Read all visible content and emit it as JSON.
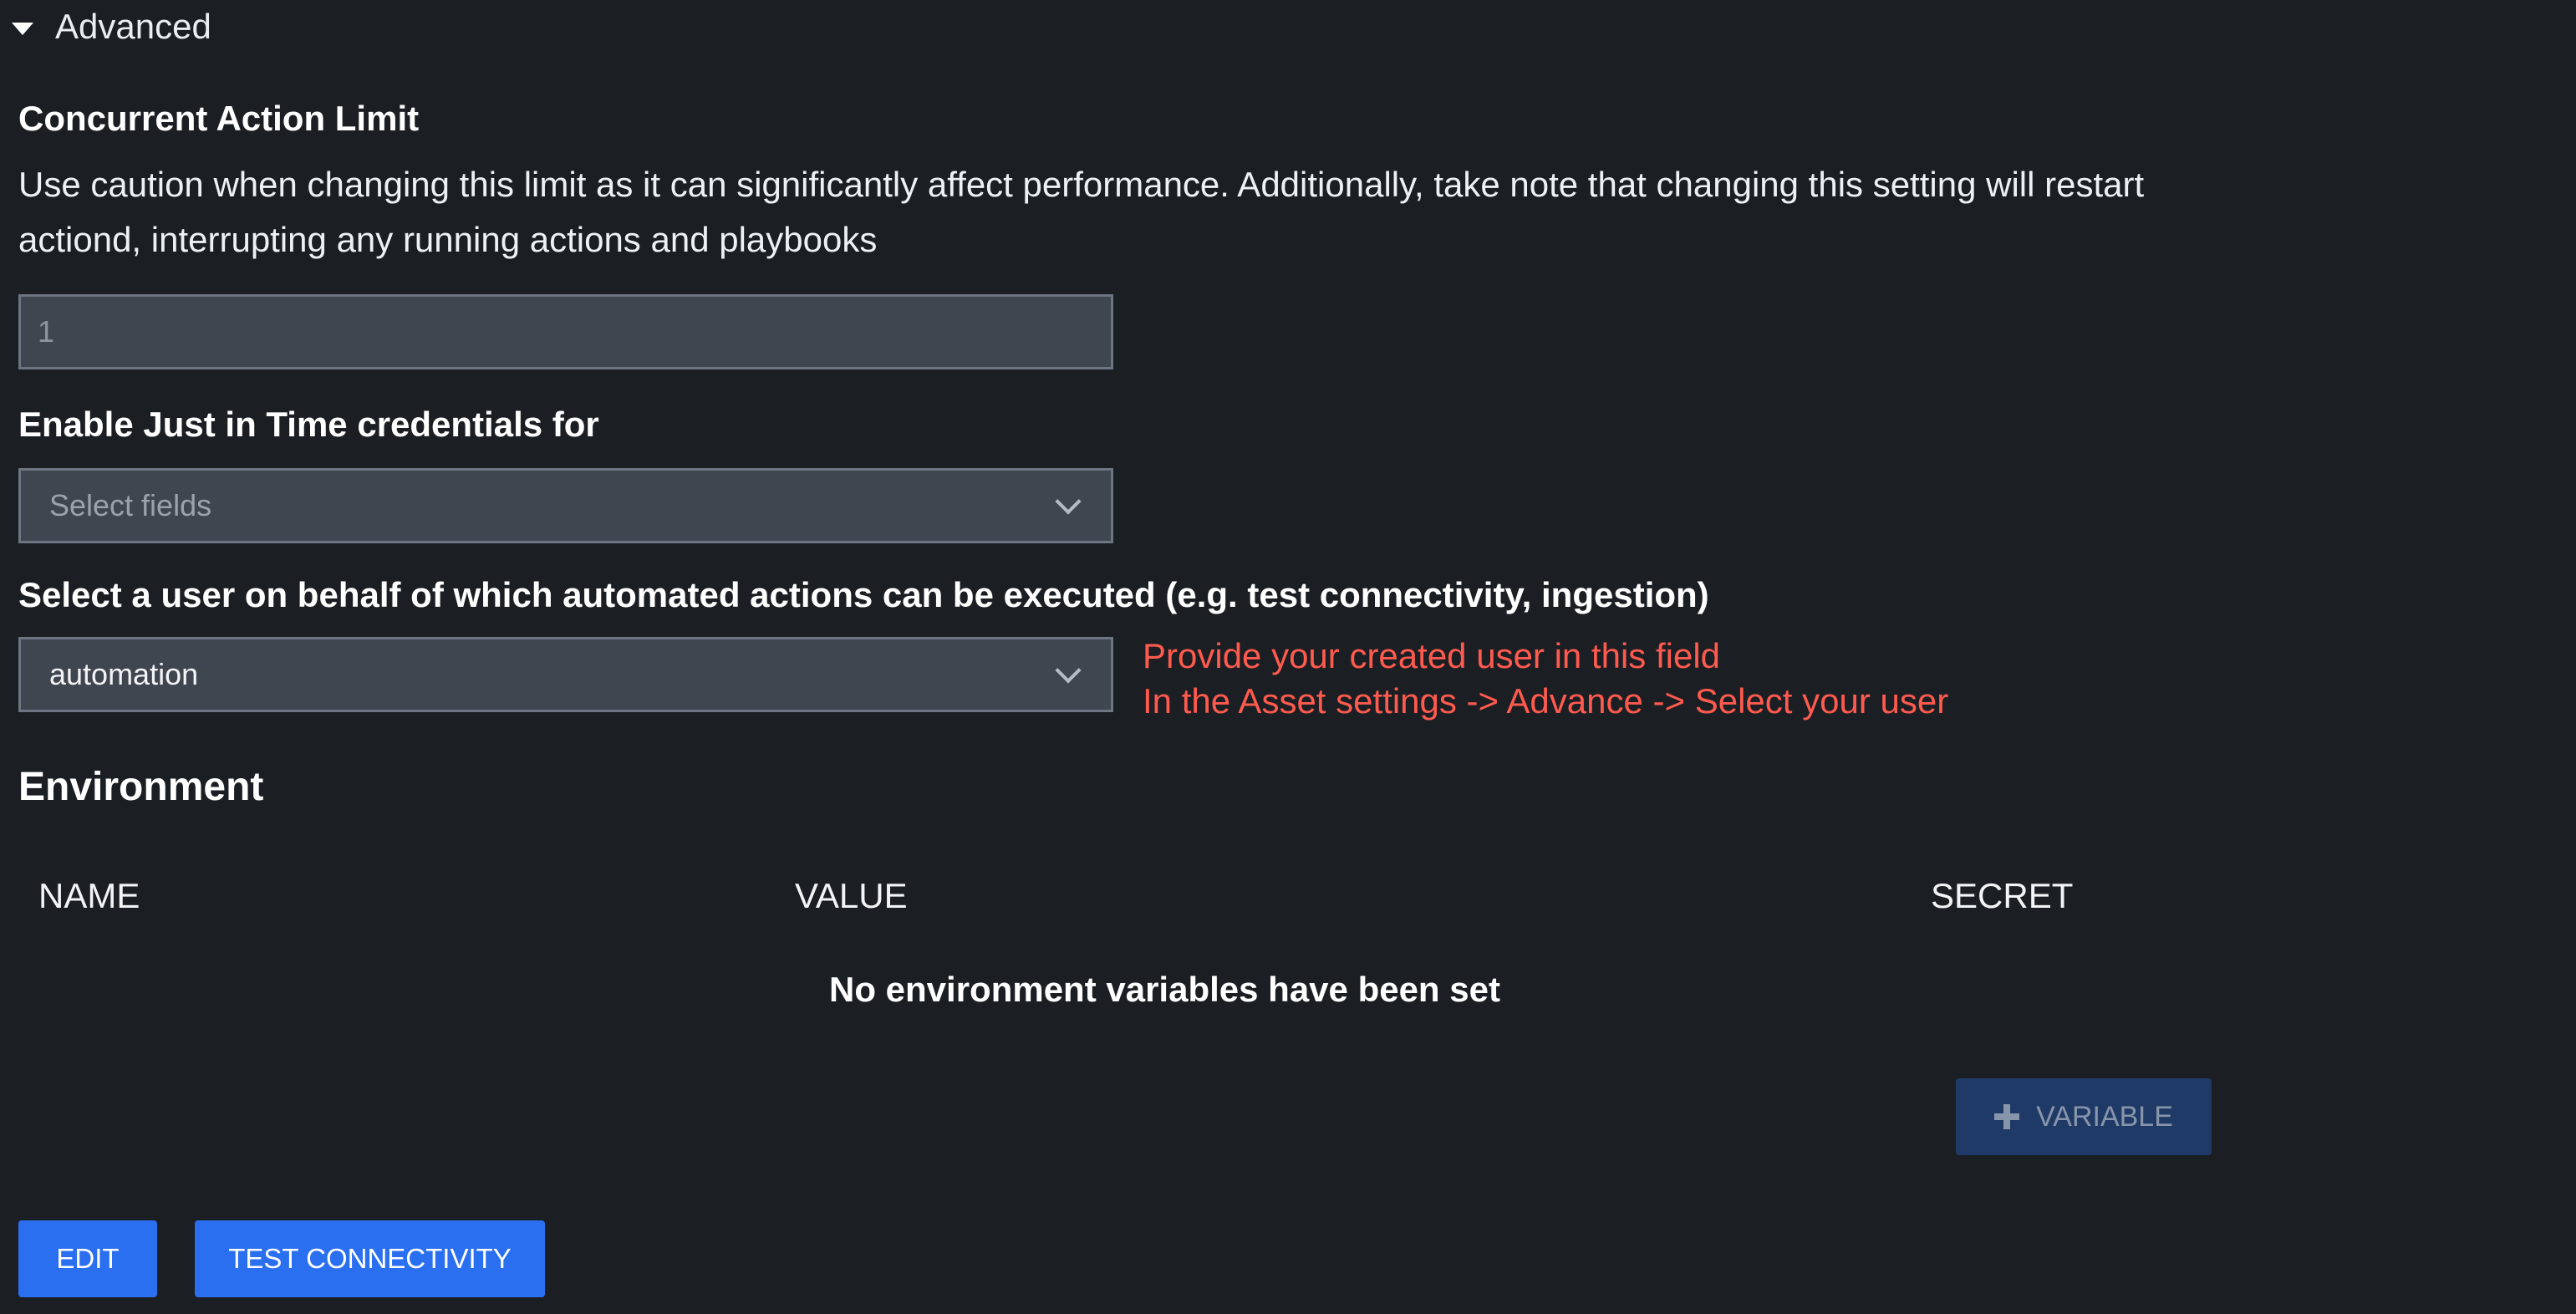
{
  "section": {
    "toggle_label": "Advanced"
  },
  "concurrent": {
    "label": "Concurrent Action Limit",
    "description": "Use caution when changing this limit as it can significantly affect performance. Additionally, take note that changing this setting will restart actiond, interrupting any running actions and playbooks",
    "value": "1"
  },
  "jit": {
    "label": "Enable Just in Time credentials for",
    "placeholder": "Select fields"
  },
  "automation_user": {
    "label": "Select a user on behalf of which automated actions can be executed (e.g. test connectivity, ingestion)",
    "selected": "automation"
  },
  "annotation": {
    "line1": "Provide your created user in this field",
    "line2": "In the Asset settings -> Advance -> Select your user"
  },
  "environment": {
    "title": "Environment",
    "columns": [
      "NAME",
      "VALUE",
      "SECRET"
    ],
    "empty_message": "No environment variables have been set",
    "add_variable_label": "VARIABLE"
  },
  "footer": {
    "edit_label": "EDIT",
    "test_connectivity_label": "TEST CONNECTIVITY"
  },
  "colors": {
    "background": "#1b1f24",
    "annotation": "#ff5a4e",
    "primary_button": "#2a6ff0",
    "disabled_button": "#1f3a66"
  },
  "icons": {
    "toggle": "caret-down-icon",
    "dropdown": "chevron-down-icon",
    "add": "plus-icon"
  }
}
